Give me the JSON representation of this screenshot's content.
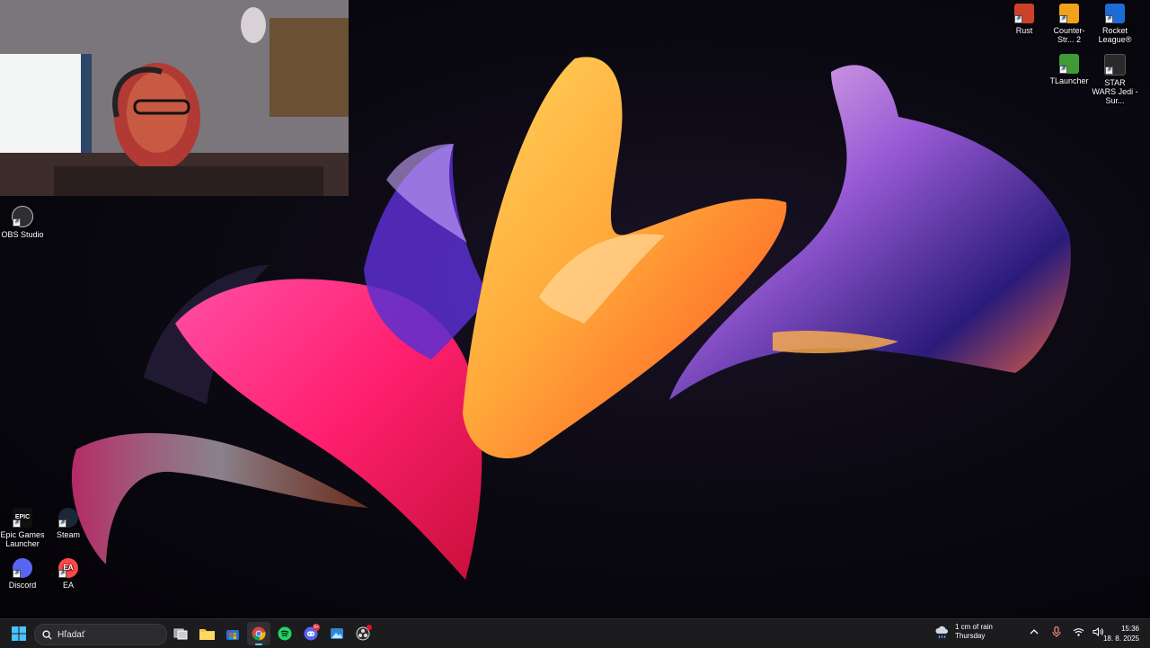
{
  "desktop_icons": {
    "rust": {
      "label": "Rust",
      "icon": "rust-icon"
    },
    "counter_strike": {
      "label": "Counter-Str... 2",
      "icon": "counter-strike-icon"
    },
    "rocket_league": {
      "label": "Rocket League®",
      "icon": "rocket-league-icon"
    },
    "tlauncher": {
      "label": "TLauncher",
      "icon": "tlauncher-icon"
    },
    "star_wars": {
      "label": "STAR WARS Jedi - Sur...",
      "icon": "star-wars-icon"
    },
    "obs": {
      "label": "OBS Studio",
      "icon": "obs-icon"
    },
    "epic": {
      "label": "Epic Games Launcher",
      "icon": "epic-games-icon",
      "glyph": "EPIC"
    },
    "steam": {
      "label": "Steam",
      "icon": "steam-icon"
    },
    "discord": {
      "label": "Discord",
      "icon": "discord-icon"
    },
    "ea": {
      "label": "EA",
      "icon": "ea-icon",
      "glyph": "EA"
    }
  },
  "taskbar": {
    "search_placeholder": "Hľadať",
    "apps": [
      {
        "name": "task-view",
        "icon": "task-view-icon"
      },
      {
        "name": "file-explorer",
        "icon": "folder-icon"
      },
      {
        "name": "store",
        "icon": "store-icon"
      },
      {
        "name": "chrome",
        "icon": "chrome-icon",
        "active": true
      },
      {
        "name": "spotify",
        "icon": "spotify-icon"
      },
      {
        "name": "discord",
        "icon": "discord-icon",
        "badge": "9+"
      },
      {
        "name": "photos",
        "icon": "photos-icon"
      },
      {
        "name": "obs",
        "icon": "obs-icon"
      }
    ],
    "weather": {
      "line1": "1 cm of rain",
      "line2": "Thursday"
    },
    "clock": {
      "time": "15:36",
      "date": "18. 8. 2025"
    }
  },
  "colors": {
    "taskbar_bg": "#1c1c1f",
    "accent": "#60cdff",
    "wallpaper_pink": "#ff2f8e",
    "wallpaper_orange": "#ff7a2a",
    "wallpaper_yellow": "#ffc43d"
  }
}
